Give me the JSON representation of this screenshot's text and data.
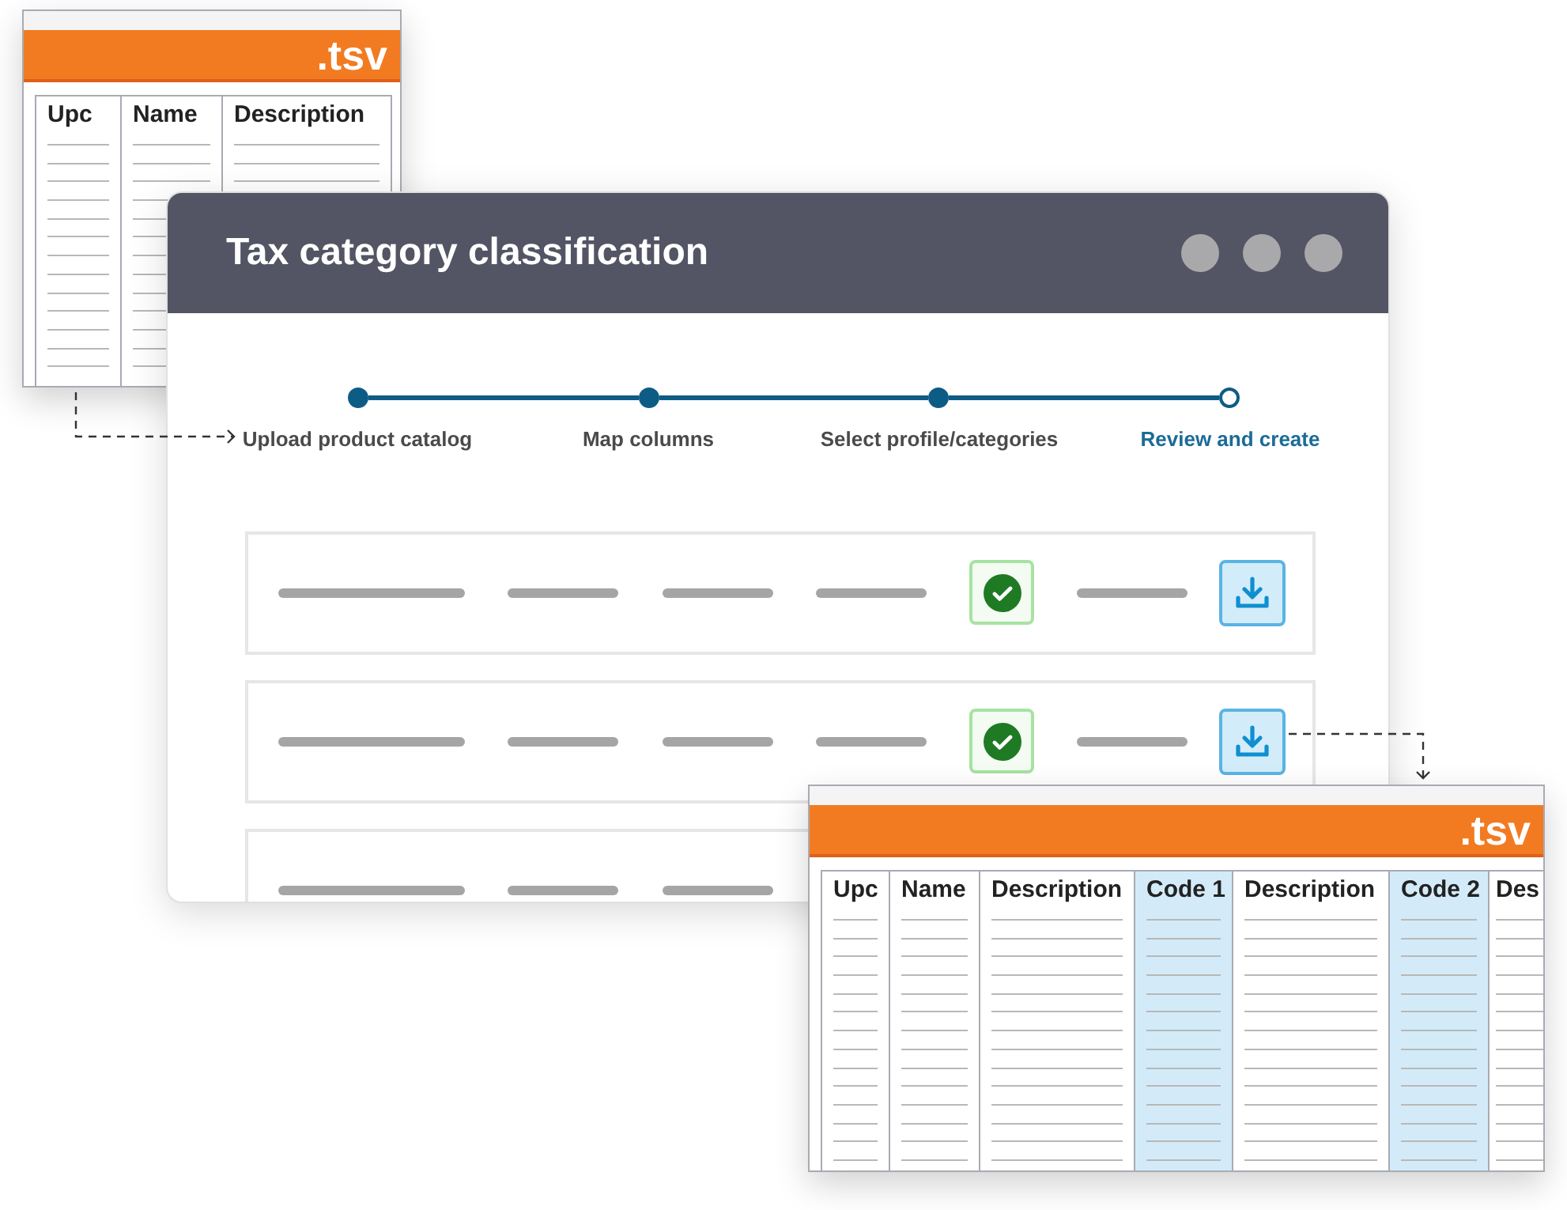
{
  "source_file": {
    "extension": ".tsv",
    "columns": [
      {
        "label": "Upc"
      },
      {
        "label": "Name"
      },
      {
        "label": "Description"
      }
    ]
  },
  "window": {
    "title": "Tax category classification"
  },
  "steps": [
    {
      "label": "Upload product catalog",
      "completed": true,
      "selected": false
    },
    {
      "label": "Map columns",
      "completed": true,
      "selected": false
    },
    {
      "label": "Select profile/categories",
      "completed": true,
      "selected": false
    },
    {
      "label": "Review and create",
      "completed": false,
      "selected": true
    }
  ],
  "rows": [
    {
      "kind": "full",
      "verified": true
    },
    {
      "kind": "full",
      "verified": true
    },
    {
      "kind": "clipped"
    }
  ],
  "result_file": {
    "extension": ".tsv",
    "columns": [
      {
        "label": "Upc",
        "highlighted": false
      },
      {
        "label": "Name",
        "highlighted": false
      },
      {
        "label": "Description",
        "highlighted": false
      },
      {
        "label": "Code 1",
        "highlighted": true
      },
      {
        "label": "Description",
        "highlighted": false
      },
      {
        "label": "Code 2",
        "highlighted": true
      },
      {
        "label": "Des",
        "highlighted": false
      }
    ]
  }
}
